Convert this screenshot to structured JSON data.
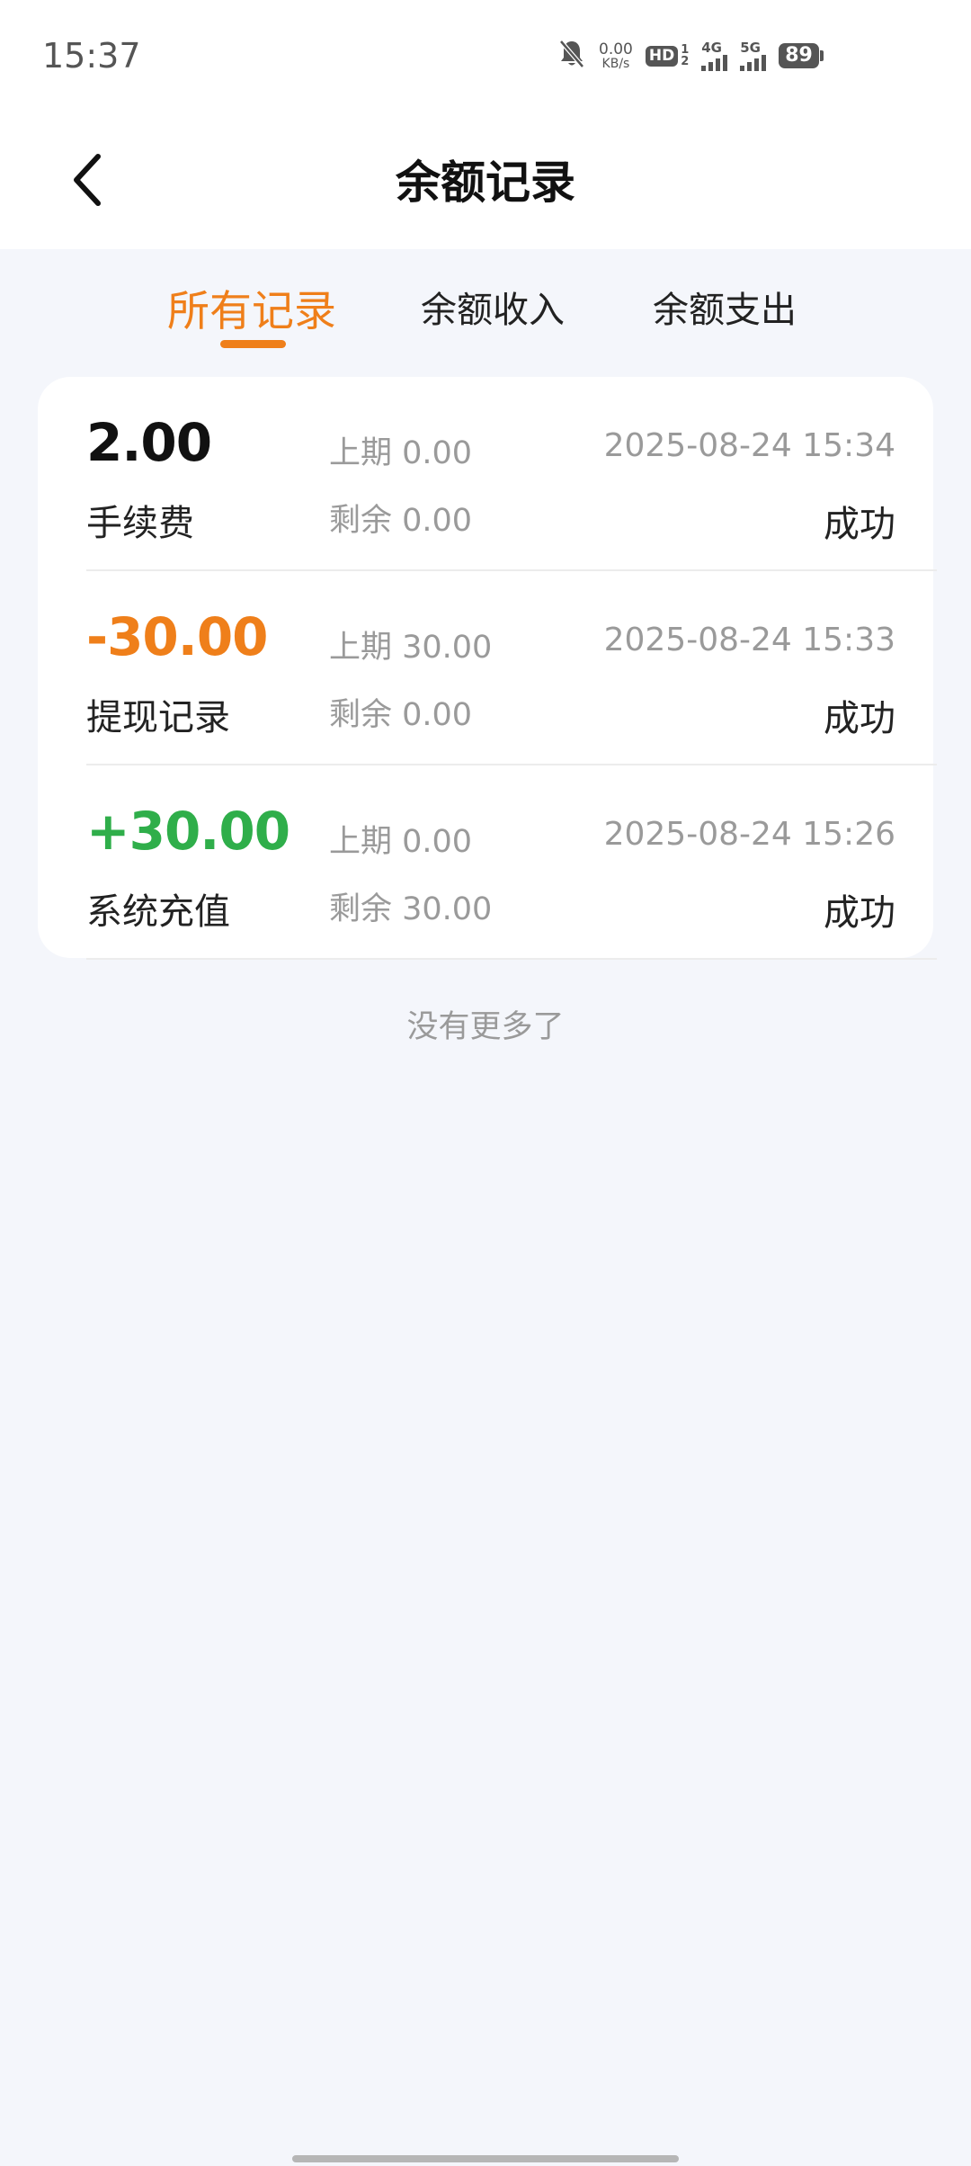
{
  "status_bar": {
    "time": "15:37",
    "net_speed_value": "0.00",
    "net_speed_unit": "KB/s",
    "hd_label": "HD",
    "hd_sim_top": "1",
    "hd_sim_bottom": "2",
    "network1": "4G",
    "network2": "5G",
    "battery": "89"
  },
  "header": {
    "title": "余额记录"
  },
  "tabs": [
    {
      "label": "所有记录",
      "active": true
    },
    {
      "label": "余额收入",
      "active": false
    },
    {
      "label": "余额支出",
      "active": false
    }
  ],
  "records": [
    {
      "amount": "2.00",
      "type": "手续费",
      "prev": "上期 0.00",
      "remain": "剩余 0.00",
      "time": "2025-08-24 15:34",
      "status": "成功",
      "amount_color": "#111111"
    },
    {
      "amount": "-30.00",
      "type": "提现记录",
      "prev": "上期 30.00",
      "remain": "剩余 0.00",
      "time": "2025-08-24 15:33",
      "status": "成功",
      "amount_color": "#ef7f1a"
    },
    {
      "amount": "+30.00",
      "type": "系统充值",
      "prev": "上期 0.00",
      "remain": "剩余 30.00",
      "time": "2025-08-24 15:26",
      "status": "成功",
      "amount_color": "#2fae4a"
    }
  ],
  "footer": {
    "no_more": "没有更多了"
  },
  "colors": {
    "accent": "#ef7f1a",
    "income": "#2fae4a",
    "background": "#f4f6fb"
  }
}
